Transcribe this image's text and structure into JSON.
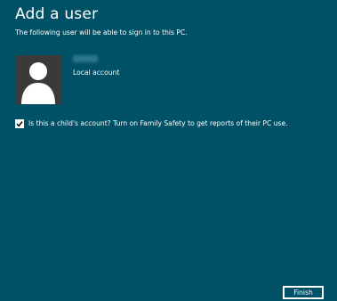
{
  "header": {
    "title": "Add a user",
    "subtitle": "The following user will be able to sign in to this PC."
  },
  "user": {
    "account_type": "Local account",
    "avatar_icon": "user-silhouette-icon"
  },
  "child_option": {
    "checked": true,
    "label": "Is this a child's account? Turn on Family Safety to get reports of their PC use."
  },
  "footer": {
    "finish_label": "Finish"
  },
  "colors": {
    "background": "#005166",
    "avatar_background": "#3a3a3a",
    "text": "#ffffff"
  }
}
